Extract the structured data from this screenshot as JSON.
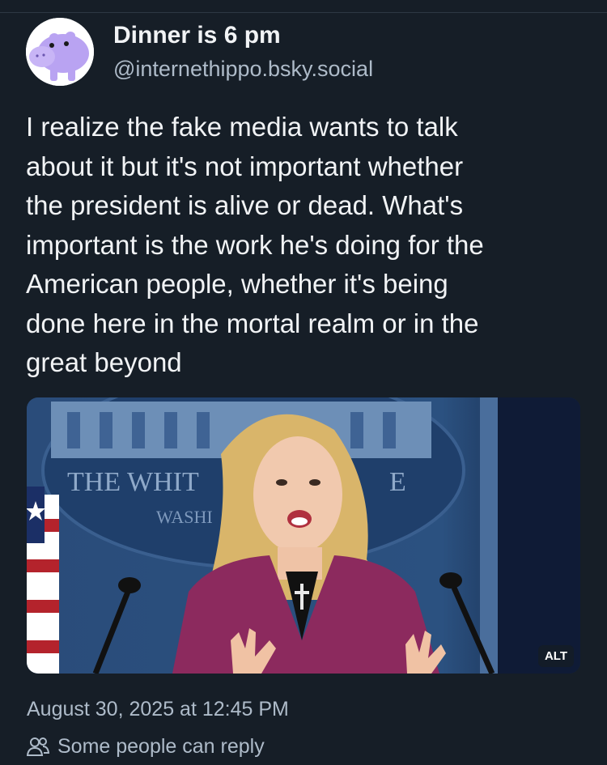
{
  "author": {
    "display_name": "Dinner is 6 pm",
    "handle": "@internethippo.bsky.social",
    "avatar_icon": "hippo-avatar-icon"
  },
  "post": {
    "text": "I realize the fake media wants to talk\nabout it but it's not important whether\nthe president is alive or dead. What's\nimportant is the work he's doing for the\nAmerican people, whether it's being\ndone here in the mortal realm or in the\ngreat beyond",
    "image": {
      "backdrop_text_line1": "THE WHIT",
      "backdrop_text_line1b": "E",
      "backdrop_text_line2": "WASHI",
      "alt_label": "ALT"
    },
    "timestamp": "August 30, 2025 at 12:45 PM",
    "reply_setting": "Some people can reply",
    "reply_icon": "people-icon"
  },
  "colors": {
    "background": "#161e27",
    "text_primary": "#f1f3f5",
    "text_secondary": "#aebbc9",
    "avatar_hippo": "#b9a3f2",
    "jacket": "#8c2a5e"
  }
}
